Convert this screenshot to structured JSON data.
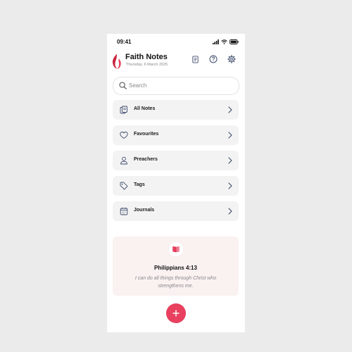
{
  "status_bar": {
    "time": "09:41"
  },
  "header": {
    "title": "Faith Notes",
    "date": "Thursday, 6 March 2025",
    "buttons": [
      "notebook-icon",
      "help-icon",
      "gear-icon"
    ]
  },
  "search": {
    "placeholder": "Search"
  },
  "menu": {
    "items": [
      {
        "label": "All Notes",
        "icon": "notes-stack-icon"
      },
      {
        "label": "Favourites",
        "icon": "heart-icon"
      },
      {
        "label": "Preachers",
        "icon": "person-icon"
      },
      {
        "label": "Tags",
        "icon": "tag-icon"
      },
      {
        "label": "Journals",
        "icon": "calendar-icon"
      }
    ]
  },
  "verse": {
    "reference": "Philippians 4:13",
    "text": "I can do all things through Christ who strengthens me.",
    "icon": "open-book-icon"
  },
  "fab": {
    "label": "+"
  },
  "colors": {
    "accent": "#e8405e",
    "card_bg": "#f3f3f3",
    "verse_bg": "#faf1f1",
    "icon_stroke": "#3d4b6b"
  }
}
